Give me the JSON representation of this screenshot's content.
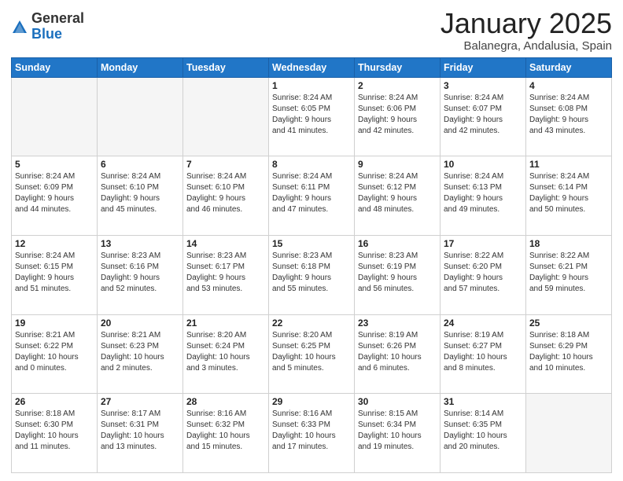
{
  "header": {
    "logo_general": "General",
    "logo_blue": "Blue",
    "month_title": "January 2025",
    "location": "Balanegra, Andalusia, Spain"
  },
  "weekdays": [
    "Sunday",
    "Monday",
    "Tuesday",
    "Wednesday",
    "Thursday",
    "Friday",
    "Saturday"
  ],
  "weeks": [
    [
      {
        "day": "",
        "info": ""
      },
      {
        "day": "",
        "info": ""
      },
      {
        "day": "",
        "info": ""
      },
      {
        "day": "1",
        "info": "Sunrise: 8:24 AM\nSunset: 6:05 PM\nDaylight: 9 hours\nand 41 minutes."
      },
      {
        "day": "2",
        "info": "Sunrise: 8:24 AM\nSunset: 6:06 PM\nDaylight: 9 hours\nand 42 minutes."
      },
      {
        "day": "3",
        "info": "Sunrise: 8:24 AM\nSunset: 6:07 PM\nDaylight: 9 hours\nand 42 minutes."
      },
      {
        "day": "4",
        "info": "Sunrise: 8:24 AM\nSunset: 6:08 PM\nDaylight: 9 hours\nand 43 minutes."
      }
    ],
    [
      {
        "day": "5",
        "info": "Sunrise: 8:24 AM\nSunset: 6:09 PM\nDaylight: 9 hours\nand 44 minutes."
      },
      {
        "day": "6",
        "info": "Sunrise: 8:24 AM\nSunset: 6:10 PM\nDaylight: 9 hours\nand 45 minutes."
      },
      {
        "day": "7",
        "info": "Sunrise: 8:24 AM\nSunset: 6:10 PM\nDaylight: 9 hours\nand 46 minutes."
      },
      {
        "day": "8",
        "info": "Sunrise: 8:24 AM\nSunset: 6:11 PM\nDaylight: 9 hours\nand 47 minutes."
      },
      {
        "day": "9",
        "info": "Sunrise: 8:24 AM\nSunset: 6:12 PM\nDaylight: 9 hours\nand 48 minutes."
      },
      {
        "day": "10",
        "info": "Sunrise: 8:24 AM\nSunset: 6:13 PM\nDaylight: 9 hours\nand 49 minutes."
      },
      {
        "day": "11",
        "info": "Sunrise: 8:24 AM\nSunset: 6:14 PM\nDaylight: 9 hours\nand 50 minutes."
      }
    ],
    [
      {
        "day": "12",
        "info": "Sunrise: 8:24 AM\nSunset: 6:15 PM\nDaylight: 9 hours\nand 51 minutes."
      },
      {
        "day": "13",
        "info": "Sunrise: 8:23 AM\nSunset: 6:16 PM\nDaylight: 9 hours\nand 52 minutes."
      },
      {
        "day": "14",
        "info": "Sunrise: 8:23 AM\nSunset: 6:17 PM\nDaylight: 9 hours\nand 53 minutes."
      },
      {
        "day": "15",
        "info": "Sunrise: 8:23 AM\nSunset: 6:18 PM\nDaylight: 9 hours\nand 55 minutes."
      },
      {
        "day": "16",
        "info": "Sunrise: 8:23 AM\nSunset: 6:19 PM\nDaylight: 9 hours\nand 56 minutes."
      },
      {
        "day": "17",
        "info": "Sunrise: 8:22 AM\nSunset: 6:20 PM\nDaylight: 9 hours\nand 57 minutes."
      },
      {
        "day": "18",
        "info": "Sunrise: 8:22 AM\nSunset: 6:21 PM\nDaylight: 9 hours\nand 59 minutes."
      }
    ],
    [
      {
        "day": "19",
        "info": "Sunrise: 8:21 AM\nSunset: 6:22 PM\nDaylight: 10 hours\nand 0 minutes."
      },
      {
        "day": "20",
        "info": "Sunrise: 8:21 AM\nSunset: 6:23 PM\nDaylight: 10 hours\nand 2 minutes."
      },
      {
        "day": "21",
        "info": "Sunrise: 8:20 AM\nSunset: 6:24 PM\nDaylight: 10 hours\nand 3 minutes."
      },
      {
        "day": "22",
        "info": "Sunrise: 8:20 AM\nSunset: 6:25 PM\nDaylight: 10 hours\nand 5 minutes."
      },
      {
        "day": "23",
        "info": "Sunrise: 8:19 AM\nSunset: 6:26 PM\nDaylight: 10 hours\nand 6 minutes."
      },
      {
        "day": "24",
        "info": "Sunrise: 8:19 AM\nSunset: 6:27 PM\nDaylight: 10 hours\nand 8 minutes."
      },
      {
        "day": "25",
        "info": "Sunrise: 8:18 AM\nSunset: 6:29 PM\nDaylight: 10 hours\nand 10 minutes."
      }
    ],
    [
      {
        "day": "26",
        "info": "Sunrise: 8:18 AM\nSunset: 6:30 PM\nDaylight: 10 hours\nand 11 minutes."
      },
      {
        "day": "27",
        "info": "Sunrise: 8:17 AM\nSunset: 6:31 PM\nDaylight: 10 hours\nand 13 minutes."
      },
      {
        "day": "28",
        "info": "Sunrise: 8:16 AM\nSunset: 6:32 PM\nDaylight: 10 hours\nand 15 minutes."
      },
      {
        "day": "29",
        "info": "Sunrise: 8:16 AM\nSunset: 6:33 PM\nDaylight: 10 hours\nand 17 minutes."
      },
      {
        "day": "30",
        "info": "Sunrise: 8:15 AM\nSunset: 6:34 PM\nDaylight: 10 hours\nand 19 minutes."
      },
      {
        "day": "31",
        "info": "Sunrise: 8:14 AM\nSunset: 6:35 PM\nDaylight: 10 hours\nand 20 minutes."
      },
      {
        "day": "",
        "info": ""
      }
    ]
  ]
}
